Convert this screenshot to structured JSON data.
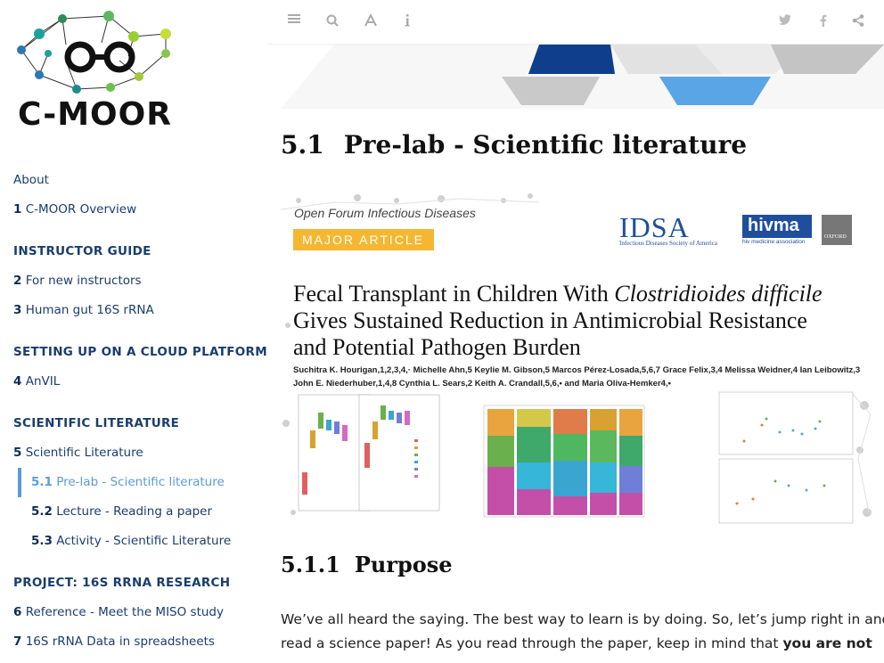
{
  "logo": {
    "text": "C-MOOR"
  },
  "nav": {
    "about": "About",
    "ch1": {
      "num": "1",
      "label": "C-MOOR Overview"
    },
    "instructor_guide": "INSTRUCTOR GUIDE",
    "ch2": {
      "num": "2",
      "label": "For new instructors"
    },
    "ch3": {
      "num": "3",
      "label": "Human gut 16S rRNA"
    },
    "cloud": "SETTING UP ON A CLOUD PLATFORM",
    "ch4": {
      "num": "4",
      "label": "AnVIL"
    },
    "sci_lit": "SCIENTIFIC LITERATURE",
    "ch5": {
      "num": "5",
      "label": "Scientific Literature"
    },
    "s51": {
      "num": "5.1",
      "label": "Pre-lab - Scientific literature"
    },
    "s52": {
      "num": "5.2",
      "label": "Lecture - Reading a paper"
    },
    "s53": {
      "num": "5.3",
      "label": "Activity - Scientific Literature"
    },
    "project": "PROJECT: 16S RRNA RESEARCH",
    "ch6": {
      "num": "6",
      "label": "Reference - Meet the MISO study"
    },
    "ch7": {
      "num": "7",
      "label": "16S rRNA Data in spreadsheets"
    }
  },
  "toolbar": {
    "icons": [
      "hamburger-icon",
      "search-icon",
      "font-icon",
      "info-icon",
      "twitter-icon",
      "facebook-icon",
      "share-icon"
    ]
  },
  "content": {
    "section": {
      "num": "5.1",
      "title": "Pre-lab - Scientific literature"
    },
    "paper": {
      "journal": "Open Forum Infectious Diseases",
      "badge": "MAJOR ARTICLE",
      "logo1": "IDSA",
      "logo1_sub": "Infectious Diseases Society of America",
      "logo2": "hivma",
      "logo2_sub": "hiv medicine association",
      "logo3": "OXFORD",
      "title_line1_a": "Fecal Transplant in Children With ",
      "title_line1_b": "Clostridioides difficile",
      "title_line2": "Gives Sustained Reduction in Antimicrobial Resistance",
      "title_line3": "and Potential Pathogen Burden",
      "authors1": "Suchitra K. Hourigan,1,2,3,4,· Michelle Ahn,5 Keylie M. Gibson,5 Marcos Pérez-Losada,5,6,7 Grace Felix,3,4 Melissa Weidner,4 Ian Leibowitz,3",
      "authors2": "John E. Niederhuber,1,4,8 Cynthia L. Sears,2 Keith A. Crandall,5,6,• and Maria Oliva-Hemker4,•"
    },
    "subsection": {
      "num": "5.1.1",
      "title": "Purpose"
    },
    "para_line1": "We’ve all heard the saying. The best way to learn is by doing. So, let’s jump right in and",
    "para_line2_a": "read a science paper! As you read through the paper, keep in mind that ",
    "para_line2_b": "you are not"
  },
  "colors": {
    "nav_text": "#1a3d6e",
    "active": "#5b9bd5",
    "badge": "#f5b731",
    "idsa_blue": "#1f4e9c"
  }
}
